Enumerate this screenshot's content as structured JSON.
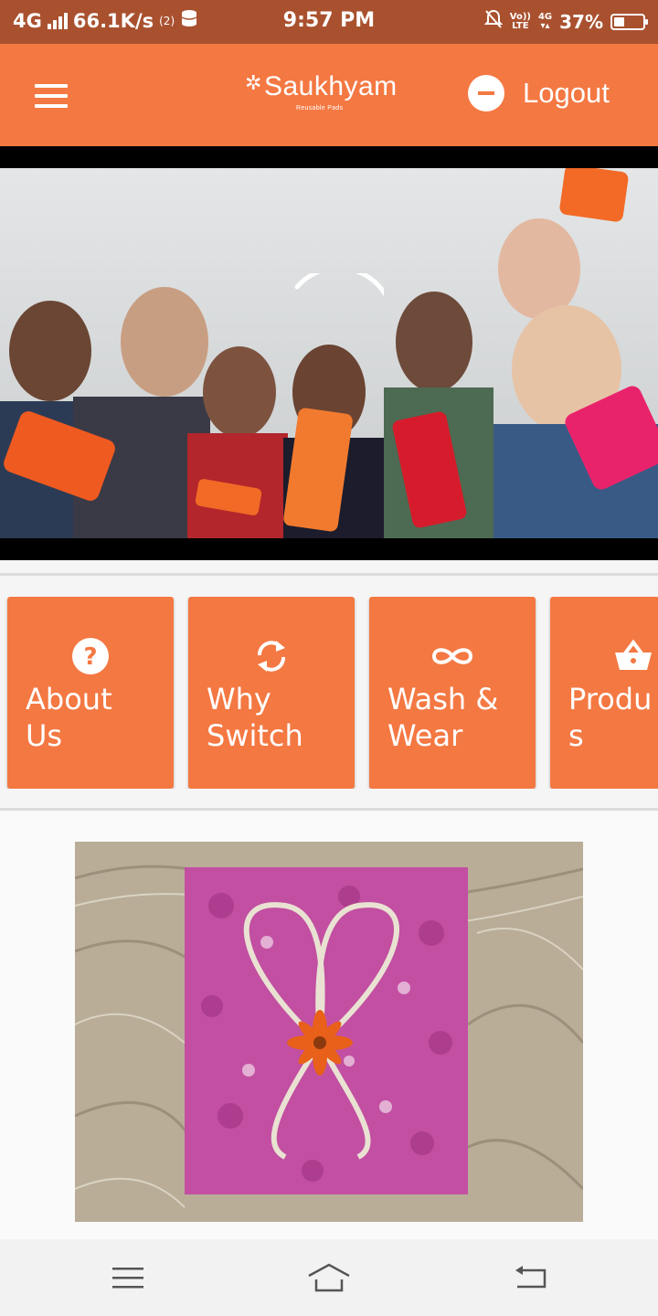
{
  "status_bar": {
    "network": "4G",
    "speed": "66.1K/s",
    "sim_badge": "(2)",
    "time": "9:57 PM",
    "volte_top": "Vo))",
    "volte_bottom": "LTE",
    "net_right": "4G",
    "battery": "37%",
    "battery_level": 0.37
  },
  "header": {
    "logo_text": "Saukhyam",
    "logo_tagline": "Reusable Pads",
    "logout_label": "Logout",
    "logout_icon": "minus-circle-icon",
    "menu_icon": "hamburger-icon"
  },
  "tiles": [
    {
      "label": "About\nUs",
      "icon": "question-circle-icon"
    },
    {
      "label": "Why\nSwitch",
      "icon": "refresh-icon"
    },
    {
      "label": "Wash &\nWear",
      "icon": "infinity-icon"
    },
    {
      "label": "Produ\ns",
      "icon": "basket-icon"
    }
  ],
  "nav_bar": {
    "menu_icon": "menu-icon",
    "home_icon": "home-icon",
    "back_icon": "back-icon"
  },
  "colors": {
    "brand_orange": "#f47842",
    "status_bar": "#a9512f"
  }
}
